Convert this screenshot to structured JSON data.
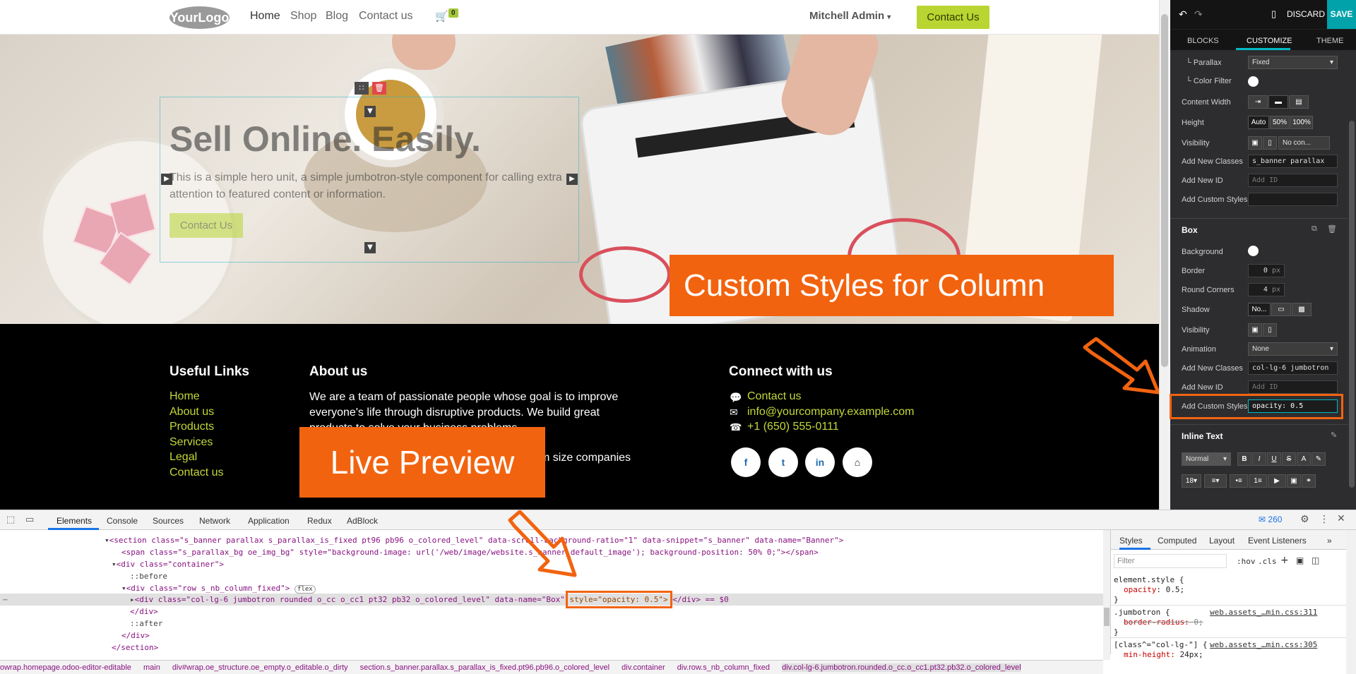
{
  "nav": {
    "logo": "YourLogo",
    "links": [
      "Home",
      "Shop",
      "Blog",
      "Contact us"
    ],
    "cart_count": "0",
    "user": "Mitchell Admin",
    "cta": "Contact Us"
  },
  "hero": {
    "title": "Sell Online. Easily.",
    "lead": "This is a simple hero unit, a simple jumbotron-style component for calling extra attention to featured content or information.",
    "button": "Contact Us",
    "callout": "Custom Styles for Column"
  },
  "footer": {
    "useful_links": {
      "heading": "Useful Links",
      "items": [
        "Home",
        "About us",
        "Products",
        "Services",
        "Legal",
        "Contact us"
      ]
    },
    "about": {
      "heading": "About us",
      "line1": "We are a team of passionate people whose goal is to improve",
      "line2": "everyone's life through disruptive products. We build great",
      "line3": "products to solve your business problems.",
      "line4": "m size companies"
    },
    "connect": {
      "heading": "Connect with us",
      "items": [
        "Contact us",
        "info@yourcompany.example.com",
        "+1 (650) 555-0111"
      ]
    },
    "social": [
      "f",
      "t",
      "in",
      "h"
    ],
    "callout": "Live Preview"
  },
  "panel": {
    "discard": "DISCARD",
    "save": "SAVE",
    "tabs": [
      "BLOCKS",
      "CUSTOMIZE",
      "THEME"
    ],
    "banner": {
      "parallax_label": "└ Parallax",
      "parallax_value": "Fixed",
      "color_filter_label": "└ Color Filter",
      "content_width_label": "Content Width",
      "height_label": "Height",
      "height_options": [
        "Auto",
        "50%",
        "100%"
      ],
      "visibility_label": "Visibility",
      "visibility_value": "No con...",
      "classes_label": "Add New Classes",
      "classes_value": "s_banner parallax",
      "id_label": "Add New ID",
      "id_placeholder": "Add ID",
      "styles_label": "Add Custom Styles"
    },
    "box": {
      "heading": "Box",
      "background_label": "Background",
      "border_label": "Border",
      "border_value": "0",
      "border_unit": "px",
      "corners_label": "Round Corners",
      "corners_value": "4",
      "corners_unit": "px",
      "shadow_label": "Shadow",
      "shadow_value": "No...",
      "visibility_label": "Visibility",
      "animation_label": "Animation",
      "animation_value": "None",
      "classes_label": "Add New Classes",
      "classes_value": "col-lg-6 jumbotron",
      "id_label": "Add New ID",
      "id_placeholder": "Add ID",
      "styles_label": "Add Custom Styles",
      "styles_value": "opacity: 0.5"
    },
    "inline_text": {
      "heading": "Inline Text",
      "format": "Normal",
      "size": "18"
    }
  },
  "devtools": {
    "tabs": [
      "Elements",
      "Console",
      "Sources",
      "Network",
      "Application",
      "Redux",
      "AdBlock"
    ],
    "issues": "260",
    "lines": [
      "<section class=\"s_banner parallax s_parallax_is_fixed pt96 pb96 o_colored_level\" data-scroll-background-ratio=\"1\" data-snippet=\"s_banner\" data-name=\"Banner\">",
      "<span class=\"s_parallax_bg oe_img_bg\" style=\"background-image: url('/web/image/website.s_banner_default_image'); background-position: 50% 0;\"></span>",
      "<div class=\"container\">",
      "::before",
      "<div class=\"row s_nb_column_fixed\">",
      "flex",
      "<div class=\"col-lg-6 jumbotron rounded o_cc o_cc1 pt32 pb32 o_colored_level\" data-name=\"Box\"",
      "style=\"opacity: 0.5\">",
      "</div> == $0",
      "</div>",
      "::after",
      "</div>",
      "</section>"
    ],
    "styles_tabs": [
      "Styles",
      "Computed",
      "Layout",
      "Event Listeners"
    ],
    "filter_placeholder": "Filter",
    "hov": ":hov",
    "cls": ".cls",
    "rules": [
      {
        "selector": "element.style {",
        "prop": "opacity",
        "value": "0.5;",
        "source": ""
      },
      {
        "selector": ".jumbotron {",
        "prop": "border-radius:",
        "value": "0;",
        "source": "web.assets_…min.css:311"
      },
      {
        "selector": "[class^=\"col-lg-\"] {",
        "prop": "min-height:",
        "value": "24px;",
        "source": "web.assets_…min.css:305"
      }
    ],
    "breadcrumbs": [
      "owrap.homepage.odoo-editor-editable",
      "main",
      "div#wrap.oe_structure.oe_empty.o_editable.o_dirty",
      "section.s_banner.parallax.s_parallax_is_fixed.pt96.pb96.o_colored_level",
      "div.container",
      "div.row.s_nb_column_fixed",
      "div.col-lg-6.jumbotron.rounded.o_cc.o_cc1.pt32.pb32.o_colored_level"
    ]
  },
  "colors": {
    "accent_orange": "#f2630f",
    "brand_green": "#b9d531",
    "save_teal": "#01a2a9"
  }
}
